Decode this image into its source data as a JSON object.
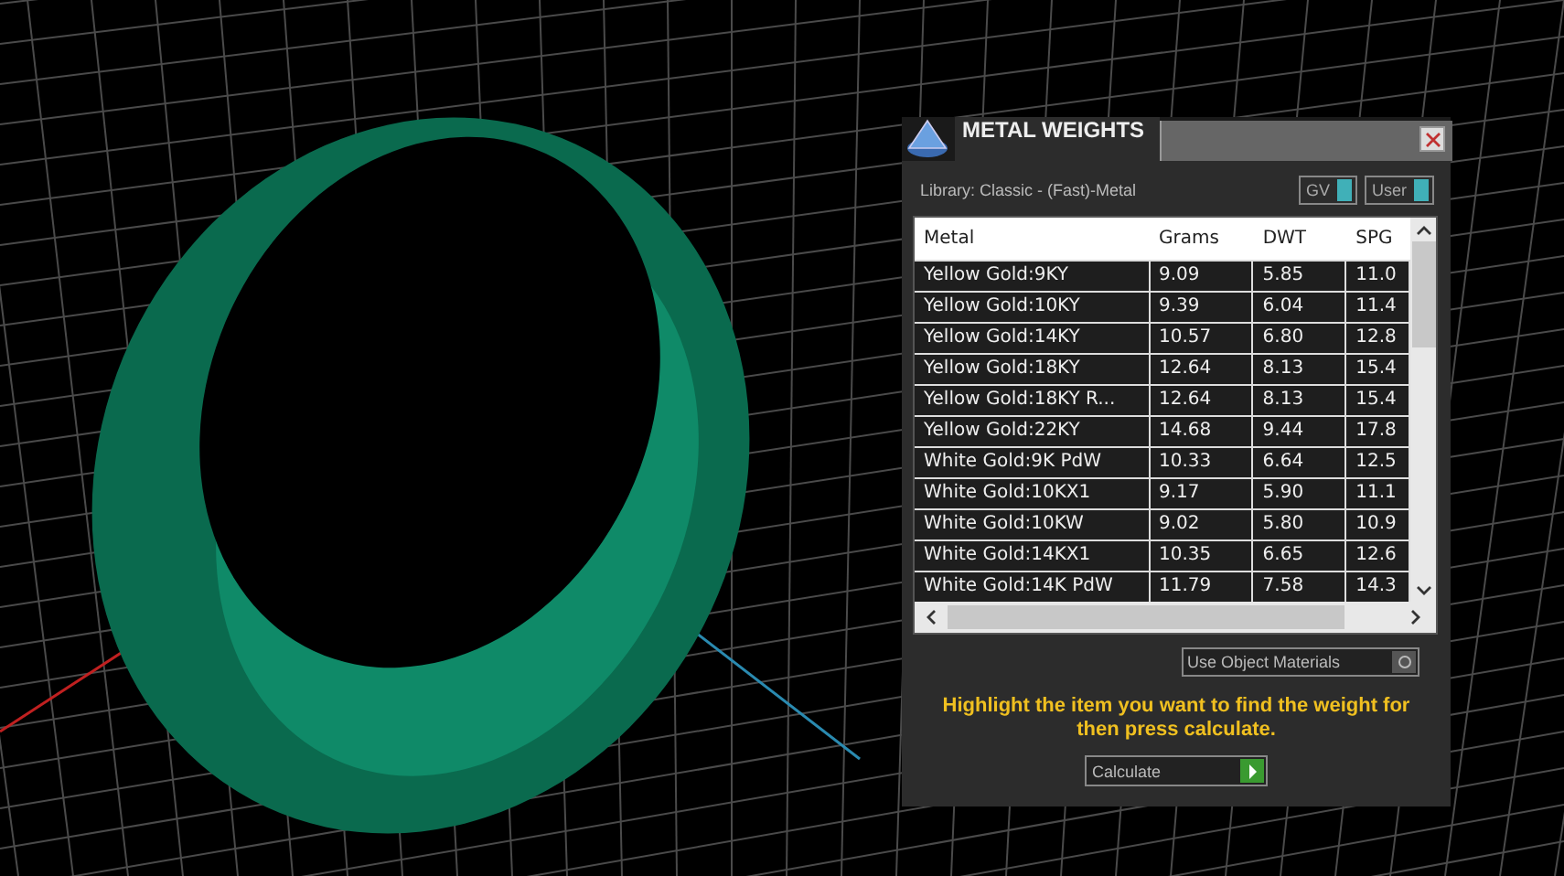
{
  "window": {
    "title": "METAL WEIGHTS"
  },
  "library": "Library: Classic - (Fast)-Metal",
  "toggles": [
    {
      "label": "GV",
      "on": true
    },
    {
      "label": "User",
      "on": true
    }
  ],
  "table": {
    "columns": [
      "Metal",
      "Grams",
      "DWT",
      "SPG"
    ],
    "rows": [
      [
        "Yellow Gold:9KY",
        "9.09",
        "5.85",
        "11.0"
      ],
      [
        "Yellow Gold:10KY",
        "9.39",
        "6.04",
        "11.4"
      ],
      [
        "Yellow Gold:14KY",
        "10.57",
        "6.80",
        "12.8"
      ],
      [
        "Yellow Gold:18KY",
        "12.64",
        "8.13",
        "15.4"
      ],
      [
        "Yellow Gold:18KY R...",
        "12.64",
        "8.13",
        "15.4"
      ],
      [
        "Yellow Gold:22KY",
        "14.68",
        "9.44",
        "17.8"
      ],
      [
        "White Gold:9K PdW",
        "10.33",
        "6.64",
        "12.5"
      ],
      [
        "White Gold:10KX1",
        "9.17",
        "5.90",
        "11.1"
      ],
      [
        "White Gold:10KW",
        "9.02",
        "5.80",
        "10.9"
      ],
      [
        "White Gold:14KX1",
        "10.35",
        "6.65",
        "12.6"
      ],
      [
        "White Gold:14K PdW",
        "11.79",
        "7.58",
        "14.3"
      ]
    ]
  },
  "materials": {
    "label": "Use Object Materials"
  },
  "hint": "Highlight the item you want to find the weight for then press calculate.",
  "calculate": {
    "label": "Calculate"
  }
}
